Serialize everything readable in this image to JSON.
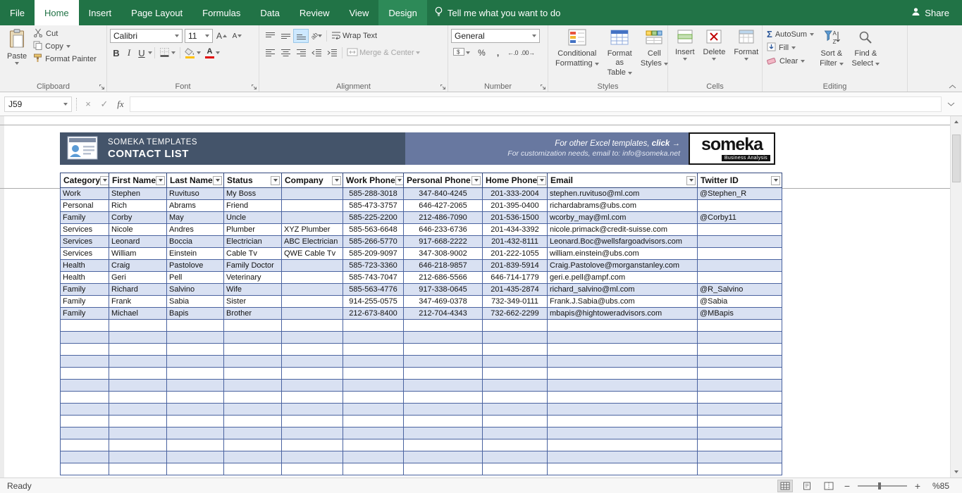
{
  "colors": {
    "excel_green": "#217346",
    "banner_dark": "#44546A",
    "banner_mid": "#6878A0",
    "row_alt": "#D9E1F2",
    "table_border": "#4A63A0",
    "fill_color_bar": "#FFC000",
    "font_color_bar": "#E00000"
  },
  "ribbon": {
    "tabs": [
      {
        "label": "File"
      },
      {
        "label": "Home"
      },
      {
        "label": "Insert"
      },
      {
        "label": "Page Layout"
      },
      {
        "label": "Formulas"
      },
      {
        "label": "Data"
      },
      {
        "label": "Review"
      },
      {
        "label": "View"
      },
      {
        "label": "Design"
      }
    ],
    "tell_me": "Tell me what you want to do",
    "share": "Share",
    "clipboard": {
      "label": "Clipboard",
      "paste": "Paste",
      "cut": "Cut",
      "copy": "Copy",
      "format_painter": "Format Painter"
    },
    "font": {
      "label": "Font",
      "name": "Calibri",
      "size": "11"
    },
    "alignment": {
      "label": "Alignment",
      "wrap_text": "Wrap Text",
      "merge_center": "Merge & Center"
    },
    "number": {
      "label": "Number",
      "format": "General"
    },
    "styles": {
      "label": "Styles",
      "conditional_line1": "Conditional",
      "conditional_line2": "Formatting",
      "table_line1": "Format as",
      "table_line2": "Table",
      "cellstyles_line1": "Cell",
      "cellstyles_line2": "Styles"
    },
    "cells": {
      "label": "Cells",
      "insert": "Insert",
      "delete": "Delete",
      "format": "Format"
    },
    "editing": {
      "label": "Editing",
      "autosum": "AutoSum",
      "fill": "Fill",
      "clear": "Clear",
      "sort_line1": "Sort &",
      "sort_line2": "Filter",
      "find_line1": "Find &",
      "find_line2": "Select"
    }
  },
  "icons": {
    "bold": "B",
    "italic": "I",
    "underline": "U",
    "autosum": "Σ",
    "percent": "%",
    "comma": ",",
    "accounting": "$",
    "increase_decimal": "←.0",
    "decrease_decimal": ".00→",
    "cancel": "×",
    "enter": "✓",
    "fx": "fx",
    "orientation": "ab"
  },
  "formula_bar": {
    "name_box": "J59",
    "value": ""
  },
  "sheet": {
    "banner": {
      "brand": "SOMEKA TEMPLATES",
      "title": "CONTACT LIST",
      "promo_pre": "For other Excel templates, ",
      "promo_click": "click →",
      "promo_line2": "For customization needs, email to: info@someka.net",
      "logo": "someka",
      "logo_sub": "Business Analysis"
    },
    "columns": [
      "Category",
      "First Name",
      "Last Name",
      "Status",
      "Company",
      "Work Phone",
      "Personal Phone",
      "Home Phone",
      "Email",
      "Twitter ID"
    ],
    "rows": [
      [
        "Work",
        "Stephen",
        "Ruvituso",
        "My Boss",
        "",
        "585-288-3018",
        "347-840-4245",
        "201-333-2004",
        "stephen.ruvituso@ml.com",
        "@Stephen_R"
      ],
      [
        "Personal",
        "Rich",
        "Abrams",
        "Friend",
        "",
        "585-473-3757",
        "646-427-2065",
        "201-395-0400",
        "richardabrams@ubs.com",
        ""
      ],
      [
        "Family",
        "Corby",
        "May",
        "Uncle",
        "",
        "585-225-2200",
        "212-486-7090",
        "201-536-1500",
        "wcorby_may@ml.com",
        "@Corby11"
      ],
      [
        "Services",
        "Nicole",
        "Andres",
        "Plumber",
        "XYZ Plumber",
        "585-563-6648",
        "646-233-6736",
        "201-434-3392",
        "nicole.primack@credit-suisse.com",
        ""
      ],
      [
        "Services",
        "Leonard",
        "Boccia",
        "Electrician",
        "ABC Electrician",
        "585-266-5770",
        "917-668-2222",
        "201-432-8111",
        "Leonard.Boc@wellsfargoadvisors.com",
        ""
      ],
      [
        "Services",
        "William",
        "Einstein",
        "Cable Tv",
        "QWE Cable Tv",
        "585-209-9097",
        "347-308-9002",
        "201-222-1055",
        "william.einstein@ubs.com",
        ""
      ],
      [
        "Health",
        "Craig",
        "Pastolove",
        "Family Doctor",
        "",
        "585-723-3360",
        "646-218-9857",
        "201-839-5914",
        "Craig.Pastolove@morganstanley.com",
        ""
      ],
      [
        "Health",
        "Geri",
        "Pell",
        "Veterinary",
        "",
        "585-743-7047",
        "212-686-5566",
        "646-714-1779",
        "geri.e.pell@ampf.com",
        ""
      ],
      [
        "Family",
        "Richard",
        "Salvino",
        "Wife",
        "",
        "585-563-4776",
        "917-338-0645",
        "201-435-2874",
        "richard_salvino@ml.com",
        "@R_Salvino"
      ],
      [
        "Family",
        "Frank",
        "Sabia",
        "Sister",
        "",
        "914-255-0575",
        "347-469-0378",
        "732-349-0111",
        "Frank.J.Sabia@ubs.com",
        "@Sabia"
      ],
      [
        "Family",
        "Michael",
        "Bapis",
        "Brother",
        "",
        "212-673-8400",
        "212-704-4343",
        "732-662-2299",
        "mbapis@hightoweradvisors.com",
        "@MBapis"
      ]
    ],
    "empty_rows": 13
  },
  "status_bar": {
    "mode": "Ready",
    "zoom_label": "%85",
    "zoom_percent": 85
  }
}
